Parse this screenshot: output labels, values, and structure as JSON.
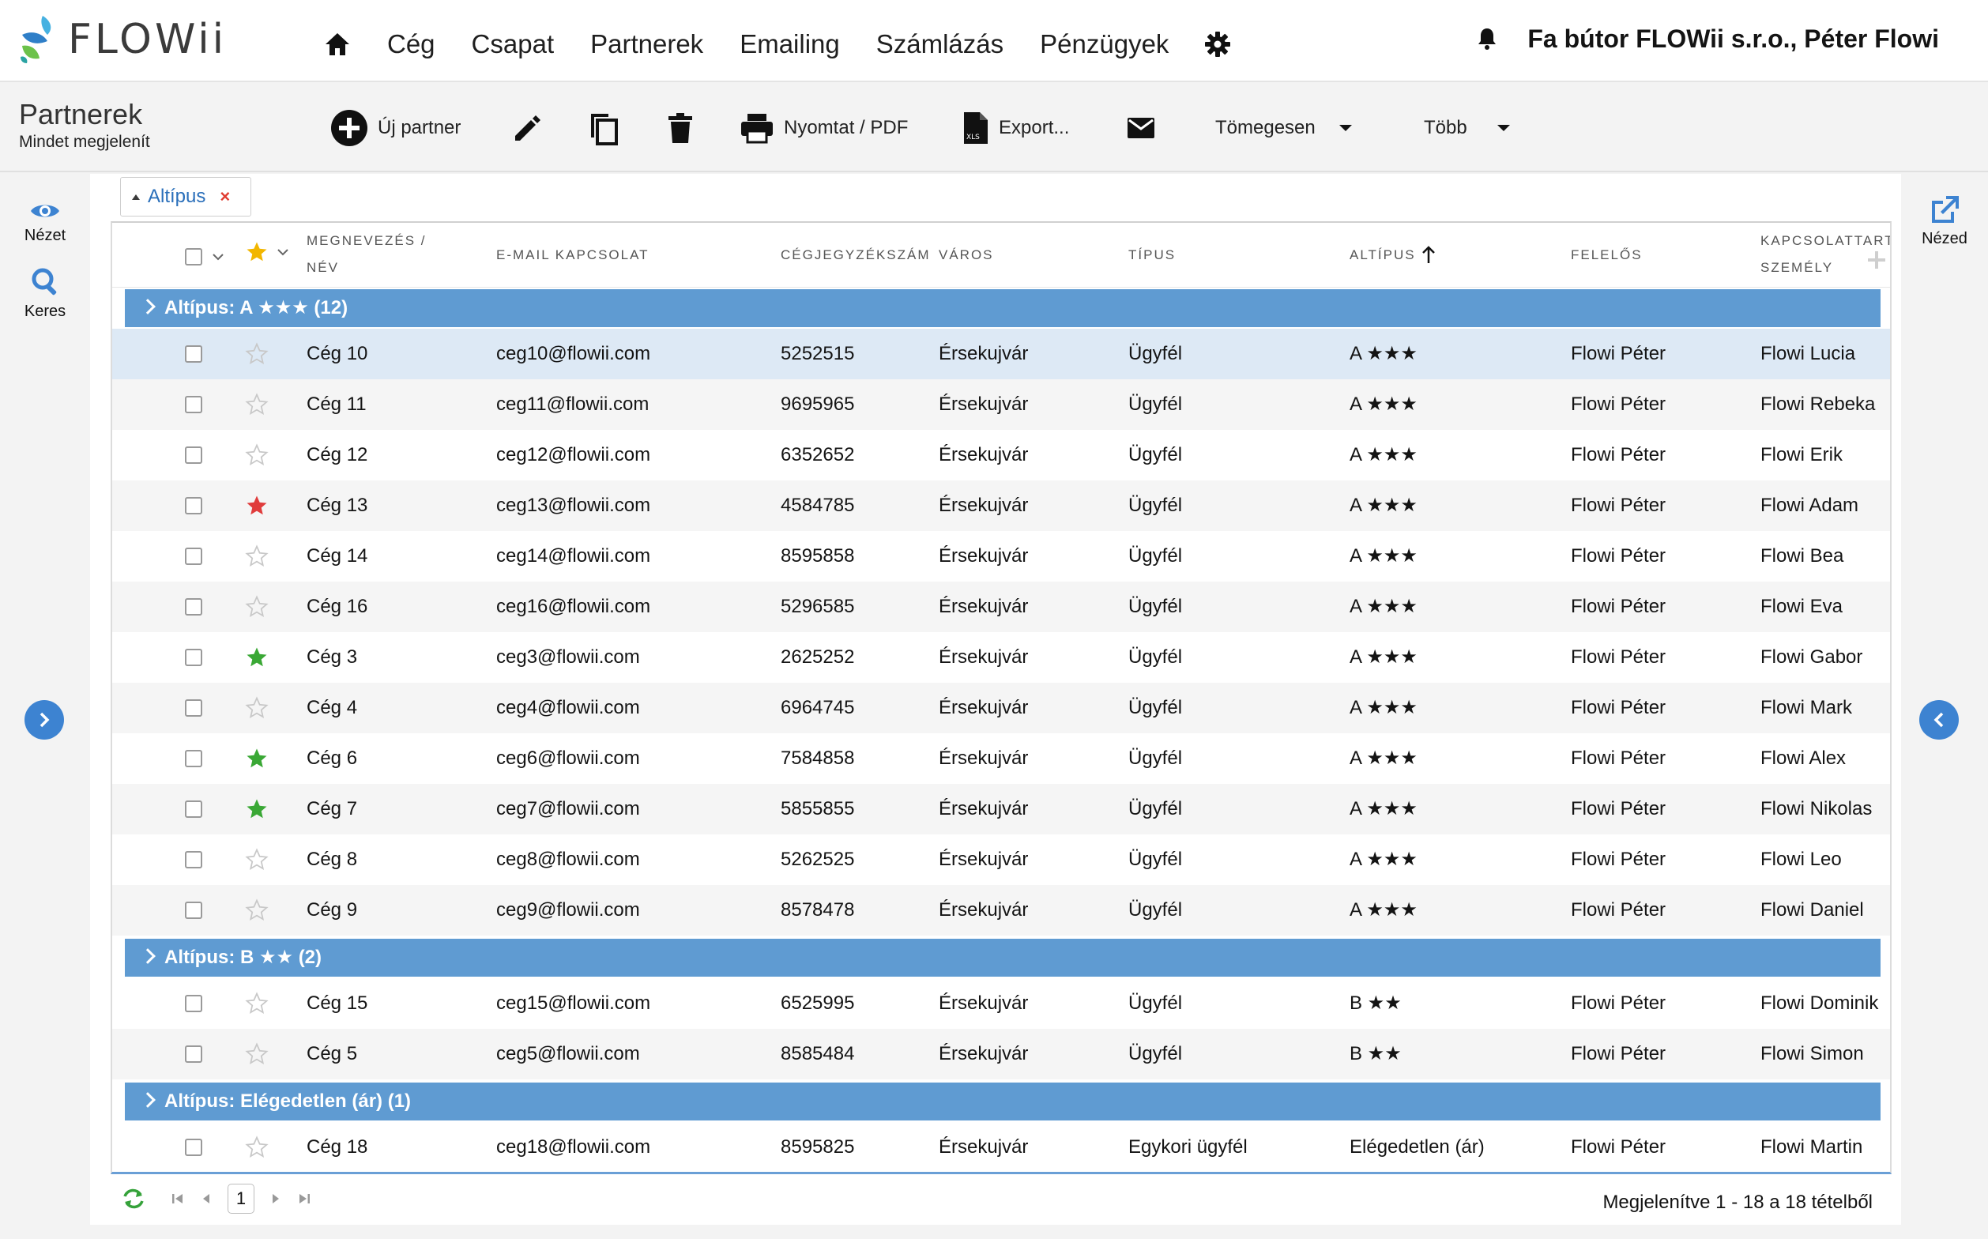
{
  "app": {
    "logo_text": "FLOWii",
    "nav": [
      "Cég",
      "Csapat",
      "Partnerek",
      "Emailing",
      "Számlázás",
      "Pénzügyek"
    ],
    "company": "Fa bútor FLOWii s.r.o., Péter Flowi"
  },
  "toolbar": {
    "title": "Partnerek",
    "subtitle": "Mindet megjelenít",
    "new_partner": "Új partner",
    "print_pdf": "Nyomtat / PDF",
    "export": "Export...",
    "bulk": "Tömegesen",
    "more": "Több"
  },
  "left_rail": {
    "view": "Nézet",
    "search": "Keres"
  },
  "right_rail": {
    "view": "Nézed"
  },
  "filter_chip": {
    "label": "Altípus",
    "remove": "×"
  },
  "columns": {
    "name_1": "MEGNEVEZÉS /",
    "name_2": "NÉV",
    "email": "E-MAIL KAPCSOLAT",
    "regno": "CÉGJEGYZÉKSZÁM",
    "city": "VÁROS",
    "type": "TÍPUS",
    "subtype": "ALTÍPUS",
    "owner": "FELELŐS",
    "contact_1": "KAPCSOLATTART",
    "contact_2": "SZEMÉLY"
  },
  "groups": [
    {
      "label": "Altípus: A ★★★ (12)",
      "rows": [
        {
          "star": "none",
          "name": "Cég 10",
          "email": "ceg10@flowii.com",
          "regno": "5252515",
          "city": "Érsekujvár",
          "type": "Ügyfél",
          "subtype": "A ★★★",
          "owner": "Flowi Péter",
          "contact": "Flowi Lucia"
        },
        {
          "star": "none",
          "name": "Cég 11",
          "email": "ceg11@flowii.com",
          "regno": "9695965",
          "city": "Érsekujvár",
          "type": "Ügyfél",
          "subtype": "A ★★★",
          "owner": "Flowi Péter",
          "contact": "Flowi Rebeka"
        },
        {
          "star": "none",
          "name": "Cég 12",
          "email": "ceg12@flowii.com",
          "regno": "6352652",
          "city": "Érsekujvár",
          "type": "Ügyfél",
          "subtype": "A ★★★",
          "owner": "Flowi Péter",
          "contact": "Flowi Erik"
        },
        {
          "star": "red",
          "name": "Cég 13",
          "email": "ceg13@flowii.com",
          "regno": "4584785",
          "city": "Érsekujvár",
          "type": "Ügyfél",
          "subtype": "A ★★★",
          "owner": "Flowi Péter",
          "contact": "Flowi Adam"
        },
        {
          "star": "none",
          "name": "Cég 14",
          "email": "ceg14@flowii.com",
          "regno": "8595858",
          "city": "Érsekujvár",
          "type": "Ügyfél",
          "subtype": "A ★★★",
          "owner": "Flowi Péter",
          "contact": "Flowi Bea"
        },
        {
          "star": "none",
          "name": "Cég 16",
          "email": "ceg16@flowii.com",
          "regno": "5296585",
          "city": "Érsekujvár",
          "type": "Ügyfél",
          "subtype": "A ★★★",
          "owner": "Flowi Péter",
          "contact": "Flowi Eva"
        },
        {
          "star": "green",
          "name": "Cég 3",
          "email": "ceg3@flowii.com",
          "regno": "2625252",
          "city": "Érsekujvár",
          "type": "Ügyfél",
          "subtype": "A ★★★",
          "owner": "Flowi Péter",
          "contact": "Flowi Gabor"
        },
        {
          "star": "none",
          "name": "Cég 4",
          "email": "ceg4@flowii.com",
          "regno": "6964745",
          "city": "Érsekujvár",
          "type": "Ügyfél",
          "subtype": "A ★★★",
          "owner": "Flowi Péter",
          "contact": "Flowi Mark"
        },
        {
          "star": "green",
          "name": "Cég 6",
          "email": "ceg6@flowii.com",
          "regno": "7584858",
          "city": "Érsekujvár",
          "type": "Ügyfél",
          "subtype": "A ★★★",
          "owner": "Flowi Péter",
          "contact": "Flowi Alex"
        },
        {
          "star": "green",
          "name": "Cég 7",
          "email": "ceg7@flowii.com",
          "regno": "5855855",
          "city": "Érsekujvár",
          "type": "Ügyfél",
          "subtype": "A ★★★",
          "owner": "Flowi Péter",
          "contact": "Flowi Nikolas"
        },
        {
          "star": "none",
          "name": "Cég 8",
          "email": "ceg8@flowii.com",
          "regno": "5262525",
          "city": "Érsekujvár",
          "type": "Ügyfél",
          "subtype": "A ★★★",
          "owner": "Flowi Péter",
          "contact": "Flowi Leo"
        },
        {
          "star": "none",
          "name": "Cég 9",
          "email": "ceg9@flowii.com",
          "regno": "8578478",
          "city": "Érsekujvár",
          "type": "Ügyfél",
          "subtype": "A ★★★",
          "owner": "Flowi Péter",
          "contact": "Flowi Daniel"
        }
      ]
    },
    {
      "label": "Altípus: B ★★ (2)",
      "rows": [
        {
          "star": "none",
          "name": "Cég 15",
          "email": "ceg15@flowii.com",
          "regno": "6525995",
          "city": "Érsekujvár",
          "type": "Ügyfél",
          "subtype": "B ★★",
          "owner": "Flowi Péter",
          "contact": "Flowi Dominik"
        },
        {
          "star": "none",
          "name": "Cég 5",
          "email": "ceg5@flowii.com",
          "regno": "8585484",
          "city": "Érsekujvár",
          "type": "Ügyfél",
          "subtype": "B ★★",
          "owner": "Flowi Péter",
          "contact": "Flowi Simon"
        }
      ]
    },
    {
      "label": "Altípus: Elégedetlen (ár) (1)",
      "rows": [
        {
          "star": "none",
          "name": "Cég 18",
          "email": "ceg18@flowii.com",
          "regno": "8595825",
          "city": "Érsekujvár",
          "type": "Egykori ügyfél",
          "subtype": "Elégedetlen (ár)",
          "owner": "Flowi Péter",
          "contact": "Flowi Martin"
        }
      ]
    }
  ],
  "footer": {
    "page": "1",
    "info": "Megjelenítve 1 - 18 a 18 tételből"
  },
  "colors": {
    "group_header": "#5f9bd2",
    "accent": "#3d83d1",
    "star_red": "#e03c3c",
    "star_green": "#3aa835",
    "star_yellow": "#f2b600"
  }
}
